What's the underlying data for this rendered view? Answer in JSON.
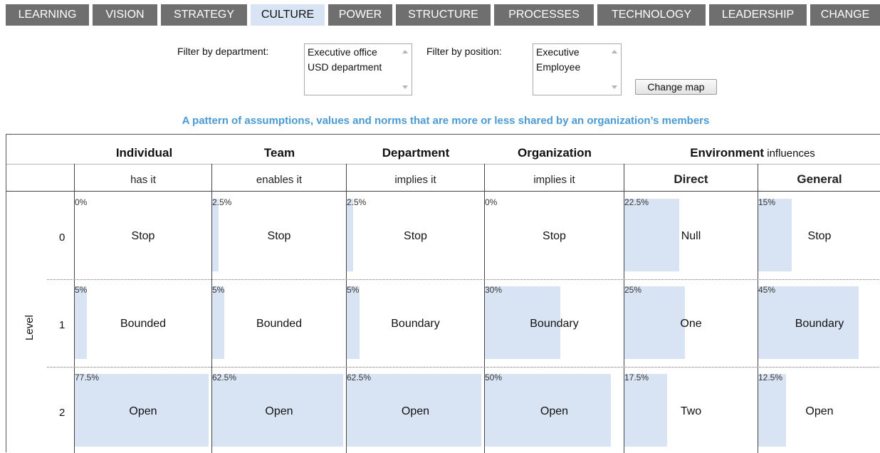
{
  "nav": {
    "tabs": [
      {
        "label": "LEARNING"
      },
      {
        "label": "VISION"
      },
      {
        "label": "STRATEGY"
      },
      {
        "label": "CULTURE"
      },
      {
        "label": "POWER"
      },
      {
        "label": "STRUCTURE"
      },
      {
        "label": "PROCESSES"
      },
      {
        "label": "TECHNOLOGY"
      },
      {
        "label": "LEADERSHIP"
      },
      {
        "label": "CHANGE"
      }
    ],
    "active_tab": "CULTURE"
  },
  "filters": {
    "department": {
      "label": "Filter by department:",
      "options": [
        "Executive office",
        "USD department"
      ]
    },
    "position": {
      "label": "Filter by position:",
      "options": [
        "Executive",
        "Employee"
      ]
    },
    "button_label": "Change map"
  },
  "subtitle": "A pattern of assumptions, values and norms that are more or less shared by an organization’s members",
  "table": {
    "level_label": "Level",
    "columns": [
      {
        "header": "Individual",
        "sub": "has it"
      },
      {
        "header": "Team",
        "sub": "enables it"
      },
      {
        "header": "Department",
        "sub": "implies it"
      },
      {
        "header": "Organization",
        "sub": "implies it"
      },
      {
        "header": "",
        "sub": "Direct"
      },
      {
        "header": "",
        "sub": "General"
      }
    ],
    "environment_header": "Environment",
    "environment_suffix": " influences",
    "rows": [
      {
        "level": "0",
        "cells": [
          {
            "pct_label": "0%",
            "value": "Stop",
            "fraction": 0.0
          },
          {
            "pct_label": "2.5%",
            "value": "Stop",
            "fraction": 0.025
          },
          {
            "pct_label": "2.5%",
            "value": "Stop",
            "fraction": 0.025
          },
          {
            "pct_label": "0%",
            "value": "Stop",
            "fraction": 0.0
          },
          {
            "pct_label": "22.5%",
            "value": "Null",
            "fraction": 0.225
          },
          {
            "pct_label": "15%",
            "value": "Stop",
            "fraction": 0.15
          }
        ]
      },
      {
        "level": "1",
        "cells": [
          {
            "pct_label": "5%",
            "value": "Bounded",
            "fraction": 0.05
          },
          {
            "pct_label": "5%",
            "value": "Bounded",
            "fraction": 0.05
          },
          {
            "pct_label": "5%",
            "value": "Boundary",
            "fraction": 0.05
          },
          {
            "pct_label": "30%",
            "value": "Boundary",
            "fraction": 0.3
          },
          {
            "pct_label": "25%",
            "value": "One",
            "fraction": 0.25
          },
          {
            "pct_label": "45%",
            "value": "Boundary",
            "fraction": 0.45
          }
        ]
      },
      {
        "level": "2",
        "cells": [
          {
            "pct_label": "77.5%",
            "value": "Open",
            "fraction": 0.775
          },
          {
            "pct_label": "62.5%",
            "value": "Open",
            "fraction": 0.625
          },
          {
            "pct_label": "62.5%",
            "value": "Open",
            "fraction": 0.625
          },
          {
            "pct_label": "50%",
            "value": "Open",
            "fraction": 0.5
          },
          {
            "pct_label": "17.5%",
            "value": "Two",
            "fraction": 0.175
          },
          {
            "pct_label": "12.5%",
            "value": "Open",
            "fraction": 0.125
          }
        ]
      }
    ]
  },
  "colors": {
    "accent": "#4a9ad3",
    "nav_bg": "#6f6f6f",
    "active_bg": "#d8e4f4",
    "bar": "#d8e4f4"
  }
}
